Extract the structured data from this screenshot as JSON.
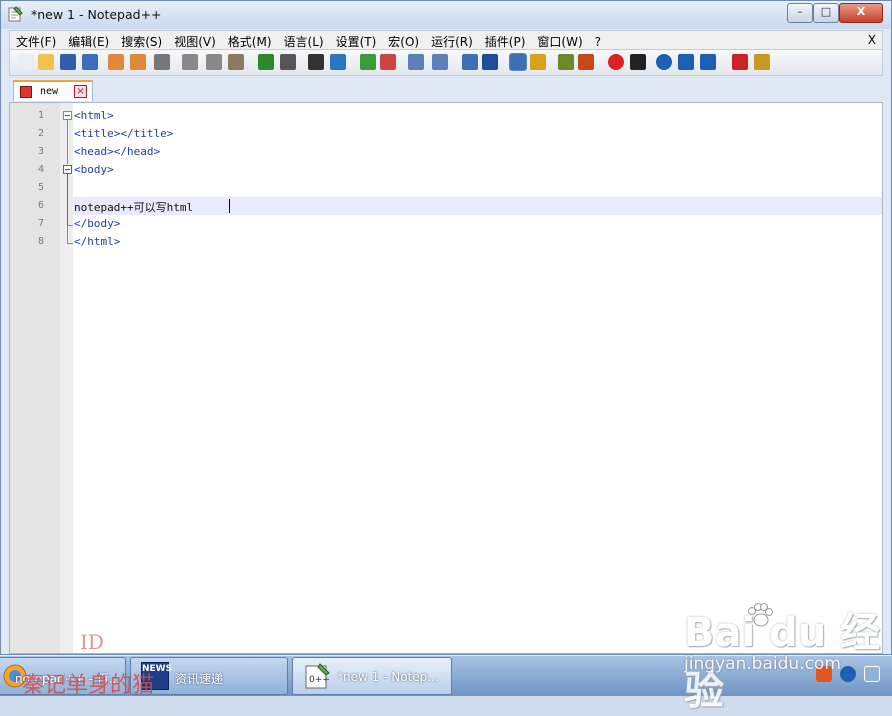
{
  "window": {
    "title": "*new  1 - Notepad++",
    "buttons": {
      "minimize": "–",
      "maximize": "□",
      "close": "X"
    }
  },
  "menubar": {
    "items": [
      "文件(F)",
      "编辑(E)",
      "搜索(S)",
      "视图(V)",
      "格式(M)",
      "语言(L)",
      "设置(T)",
      "宏(O)",
      "运行(R)",
      "插件(P)",
      "窗口(W)",
      "?"
    ],
    "close_label": "X"
  },
  "toolbar": {
    "icons": [
      "new-file-icon",
      "open-file-icon",
      "save-icon",
      "save-all-icon",
      "close-icon",
      "close-all-icon",
      "print-icon",
      "cut-icon",
      "copy-icon",
      "paste-icon",
      "undo-icon",
      "redo-icon",
      "find-icon",
      "replace-icon",
      "zoom-in-icon",
      "zoom-out-icon",
      "sync-vertical-icon",
      "sync-horizontal-icon",
      "word-wrap-icon",
      "show-all-chars-icon",
      "indent-guide-icon",
      "user-lang-icon",
      "doc-map-icon",
      "function-list-icon",
      "record-macro-icon",
      "stop-record-icon",
      "play-macro-icon",
      "run-macro-multiple-icon",
      "save-macro-icon",
      "spell-check-icon",
      "spell-options-icon"
    ]
  },
  "tabs": [
    {
      "label": "new",
      "close": "×"
    }
  ],
  "editor": {
    "lines": [
      {
        "num": "1",
        "text": "<html>"
      },
      {
        "num": "2",
        "text": "<title></title>"
      },
      {
        "num": "3",
        "text": "<head></head>"
      },
      {
        "num": "4",
        "text": "<body>"
      },
      {
        "num": "5",
        "text": ""
      },
      {
        "num": "6",
        "text": "notepad++可以写html"
      },
      {
        "num": "7",
        "text": "</body>"
      },
      {
        "num": "8",
        "text": "</html>"
      }
    ],
    "current_line": 6
  },
  "taskbar": {
    "items": [
      {
        "label": "notepad++ - 百..."
      },
      {
        "label": "资讯速递",
        "icon_text": "NEWS"
      },
      {
        "label": "*new  1 - Notep..."
      }
    ]
  },
  "colors": {
    "tag": "#1f3ba6",
    "current_line": "#e8e8ff",
    "tab_accent": "#f0a23a"
  }
}
